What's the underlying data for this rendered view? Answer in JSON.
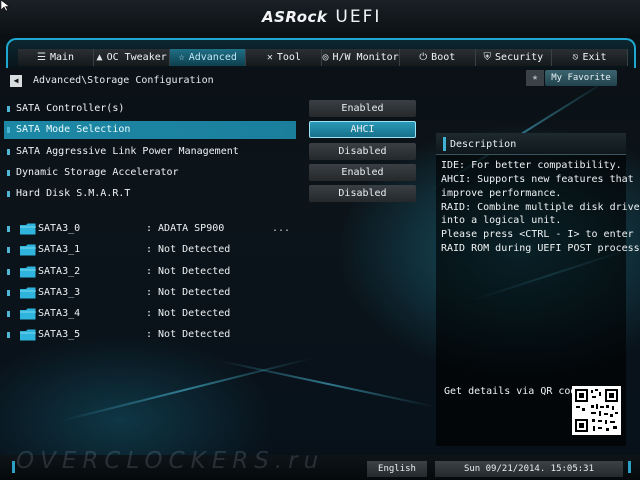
{
  "header": {
    "brand": "ASRock",
    "product": "UEFI"
  },
  "tabs": [
    {
      "label": "Main",
      "icon": "list-icon",
      "active": false
    },
    {
      "label": "OC Tweaker",
      "icon": "rocket-icon",
      "active": false
    },
    {
      "label": "Advanced",
      "icon": "star-icon",
      "active": true
    },
    {
      "label": "Tool",
      "icon": "tools-icon",
      "active": false
    },
    {
      "label": "H/W Monitor",
      "icon": "monitor-icon",
      "active": false
    },
    {
      "label": "Boot",
      "icon": "power-icon",
      "active": false
    },
    {
      "label": "Security",
      "icon": "shield-icon",
      "active": false
    },
    {
      "label": "Exit",
      "icon": "exit-icon",
      "active": false
    }
  ],
  "breadcrumb": "Advanced\\Storage Configuration",
  "favorite": {
    "label": "My Favorite"
  },
  "settings": [
    {
      "label": "SATA Controller(s)",
      "value": "Enabled",
      "selected": false
    },
    {
      "label": "SATA Mode Selection",
      "value": "AHCI",
      "selected": true
    },
    {
      "label": "SATA Aggressive Link Power Management",
      "value": "Disabled",
      "selected": false
    },
    {
      "label": "Dynamic Storage Accelerator",
      "value": "Enabled",
      "selected": false
    },
    {
      "label": "Hard Disk S.M.A.R.T",
      "value": "Disabled",
      "selected": false
    }
  ],
  "drives": [
    {
      "port": "SATA3_0",
      "device": ": ADATA SP900",
      "more": "..."
    },
    {
      "port": "SATA3_1",
      "device": ": Not Detected",
      "more": ""
    },
    {
      "port": "SATA3_2",
      "device": ": Not Detected",
      "more": ""
    },
    {
      "port": "SATA3_3",
      "device": ": Not Detected",
      "more": ""
    },
    {
      "port": "SATA3_4",
      "device": ": Not Detected",
      "more": ""
    },
    {
      "port": "SATA3_5",
      "device": ": Not Detected",
      "more": ""
    }
  ],
  "description": {
    "title": "Description",
    "lines": [
      "IDE: For better compatibility.",
      "AHCI: Supports new features that",
      "improve performance.",
      "RAID: Combine multiple disk drives",
      "into a logical unit.",
      "Please press <CTRL - I> to enter",
      "RAID ROM during UEFI POST process."
    ],
    "qr_label": "Get details via QR code"
  },
  "footer": {
    "watermark": "OVERCLOCKERS.ru",
    "language": "English",
    "datetime": "Sun 09/21/2014. 15:05:31"
  },
  "colors": {
    "accent": "#1ea8d0",
    "selected_row": "#1c88a5",
    "panel": "#000000"
  }
}
